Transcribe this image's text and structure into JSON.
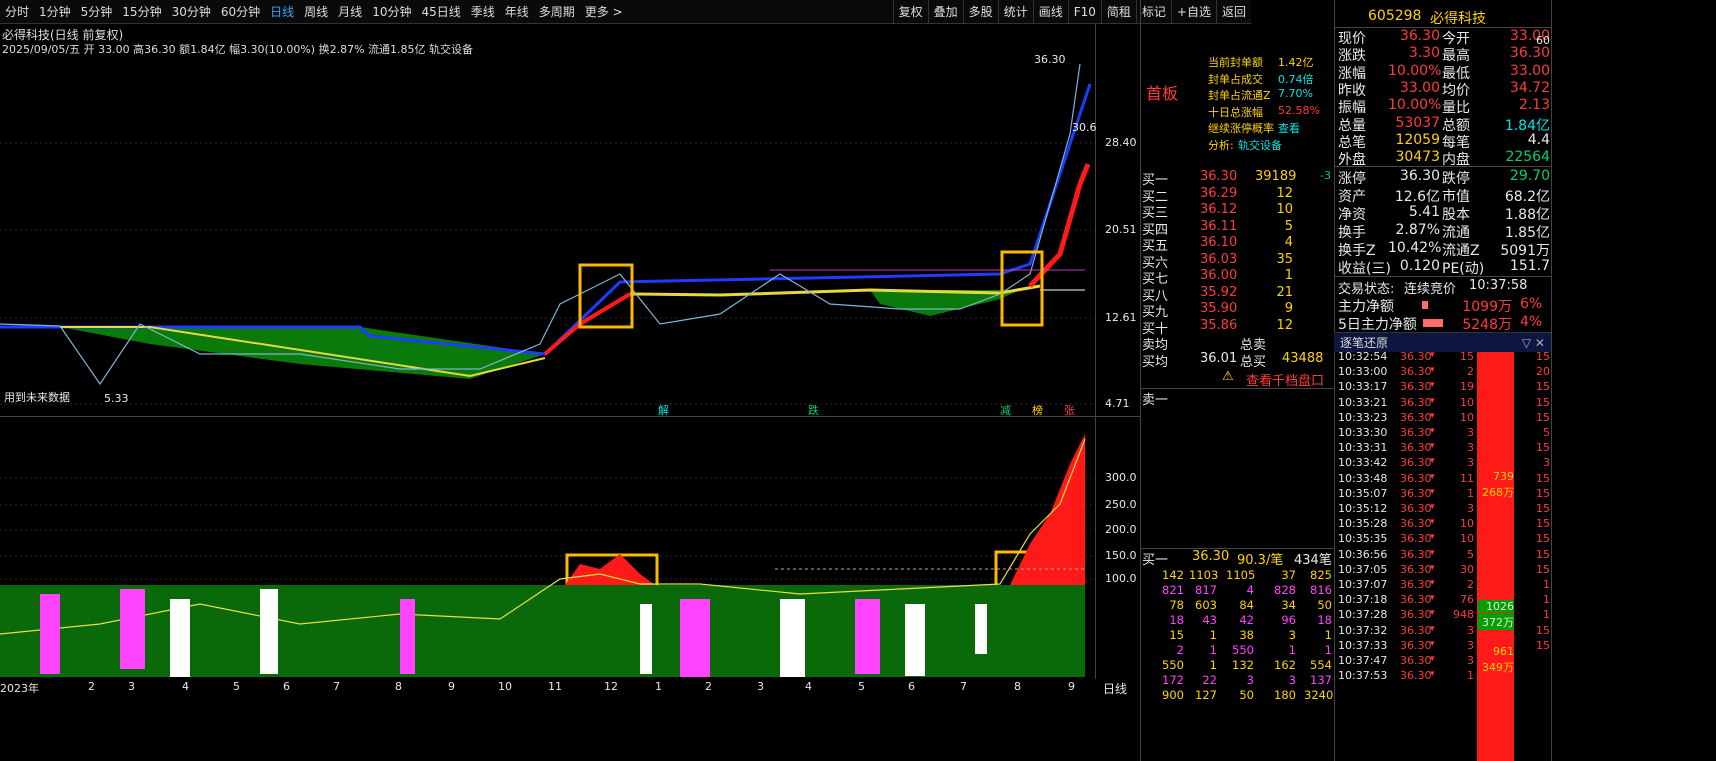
{
  "toolbar": {
    "left": [
      "分时",
      "1分钟",
      "5分钟",
      "15分钟",
      "30分钟",
      "60分钟",
      "日线",
      "周线",
      "月线",
      "10分钟",
      "45日线",
      "季线",
      "年线",
      "多周期",
      "更多 >"
    ],
    "selected": "日线",
    "right": [
      "复权",
      "叠加",
      "多股",
      "统计",
      "画线",
      "F10",
      "简租",
      "标记",
      "+自选",
      "返回"
    ]
  },
  "chart": {
    "title": "必得科技(日线 前复权)",
    "info": "2025/09/05/五 开 33.00 高36.30 额1.84亿 幅3.30(10.00%) 换2.87% 流通1.85亿 轨交设备",
    "yticks_main": [
      "28.40",
      "20.51",
      "12.61",
      "4.71"
    ],
    "high_label": "36.30",
    "low_label": "5.33",
    "price_right": "30.6",
    "yticks_sub": [
      "300.0",
      "250.0",
      "200.0",
      "150.0",
      "100.0"
    ],
    "future_note": "用到未来数据",
    "period_label": "日线",
    "xlabels": [
      "2023年",
      "2",
      "3",
      "4",
      "5",
      "6",
      "7",
      "8",
      "9",
      "10",
      "11",
      "12",
      "1",
      "2",
      "3",
      "4",
      "5",
      "6",
      "7",
      "8",
      "9"
    ],
    "markers": [
      "解",
      "跌",
      "减",
      "榜",
      "张"
    ]
  },
  "popup": {
    "title": "首板",
    "rows": [
      [
        "当前封单额",
        "1.42亿"
      ],
      [
        "封单占成交",
        "0.74倍"
      ],
      [
        "封单占流通Z",
        "7.70%"
      ],
      [
        "十日总涨幅",
        "52.58%"
      ],
      [
        "继续涨停概率",
        "查看"
      ],
      [
        "分析:",
        "轨交设备"
      ]
    ]
  },
  "stock": {
    "code": "605298",
    "name": "必得科技"
  },
  "quote": [
    [
      "现价",
      "36.30",
      "今开",
      "33.00"
    ],
    [
      "涨跌",
      "3.30",
      "最高",
      "36.30"
    ],
    [
      "涨幅",
      "10.00%",
      "最低",
      "33.00"
    ],
    [
      "昨收",
      "33.00",
      "均价",
      "34.72"
    ],
    [
      "振幅",
      "10.00%",
      "量比",
      "2.13"
    ],
    [
      "总量",
      "53037",
      "总额",
      "1.84亿"
    ],
    [
      "总笔",
      "12059",
      "每笔",
      "4.4"
    ],
    [
      "外盘",
      "30473",
      "内盘",
      "22564"
    ]
  ],
  "quote2": [
    [
      "涨停",
      "36.30",
      "跌停",
      "29.70"
    ],
    [
      "资产",
      "12.6亿",
      "市值",
      "68.2亿"
    ],
    [
      "净资",
      "5.41",
      "股本",
      "1.88亿"
    ],
    [
      "换手",
      "2.87%",
      "流通",
      "1.85亿"
    ],
    [
      "换手Z",
      "10.42%",
      "流通Z",
      "5091万"
    ],
    [
      "收益(三)",
      "0.120",
      "PE(动)",
      "151.7"
    ]
  ],
  "status": {
    "label": "交易状态:",
    "value": "连续竞价",
    "time": "10:37:58"
  },
  "flow": [
    [
      "主力净额",
      "1099万",
      "6%"
    ],
    [
      "5日主力净额",
      "5248万",
      "4%"
    ]
  ],
  "buys": [
    [
      "买一",
      "36.30",
      "39189",
      "-3"
    ],
    [
      "买二",
      "36.29",
      "12",
      ""
    ],
    [
      "买三",
      "36.12",
      "10",
      ""
    ],
    [
      "买四",
      "36.11",
      "5",
      ""
    ],
    [
      "买五",
      "36.10",
      "4",
      ""
    ],
    [
      "买六",
      "36.03",
      "35",
      ""
    ],
    [
      "买七",
      "36.00",
      "1",
      ""
    ],
    [
      "买八",
      "35.92",
      "21",
      ""
    ],
    [
      "买九",
      "35.90",
      "9",
      ""
    ],
    [
      "买十",
      "35.86",
      "12",
      ""
    ]
  ],
  "avg": {
    "sell_label": "卖均",
    "sell_total": "总卖",
    "buy_label": "买均",
    "buy_avg": "36.01",
    "buy_total_label": "总买",
    "buy_total": "43488"
  },
  "depth_link": "查看千档盘口",
  "sell1": "卖一",
  "queue": {
    "label": "买一",
    "price": "36.30",
    "avg": "90.3/笔",
    "count": "434笔",
    "rows": [
      [
        "142",
        "1103",
        "1105",
        "37",
        "825"
      ],
      [
        "821",
        "817",
        "4",
        "828",
        "816"
      ],
      [
        "78",
        "603",
        "84",
        "34",
        "50"
      ],
      [
        "18",
        "43",
        "42",
        "96",
        "18"
      ],
      [
        "15",
        "1",
        "38",
        "3",
        "1"
      ],
      [
        "2",
        "1",
        "550",
        "1",
        "1"
      ],
      [
        "550",
        "1",
        "132",
        "162",
        "554"
      ],
      [
        "172",
        "22",
        "3",
        "3",
        "137"
      ],
      [
        "900",
        "127",
        "50",
        "180",
        "3240"
      ]
    ]
  },
  "tick_header": "逐笔还原",
  "ticks": [
    [
      "10:32:54",
      "36.30",
      "15"
    ],
    [
      "10:33:00",
      "36.30",
      "2"
    ],
    [
      "10:33:17",
      "36.30",
      "19"
    ],
    [
      "10:33:21",
      "36.30",
      "10"
    ],
    [
      "10:33:23",
      "36.30",
      "10"
    ],
    [
      "10:33:30",
      "36.30",
      "3"
    ],
    [
      "10:33:31",
      "36.30",
      "3"
    ],
    [
      "10:33:42",
      "36.30",
      "3"
    ],
    [
      "10:33:48",
      "36.30",
      "11"
    ],
    [
      "10:35:07",
      "36.30",
      "1"
    ],
    [
      "10:35:12",
      "36.30",
      "3"
    ],
    [
      "10:35:28",
      "36.30",
      "10"
    ],
    [
      "10:35:35",
      "36.30",
      "10"
    ],
    [
      "10:36:56",
      "36.30",
      "5"
    ],
    [
      "10:37:05",
      "36.30",
      "30"
    ],
    [
      "10:37:07",
      "36.30",
      "2"
    ],
    [
      "10:37:18",
      "36.30",
      "76"
    ],
    [
      "10:37:28",
      "36.30",
      "948"
    ],
    [
      "10:37:32",
      "36.30",
      "3"
    ],
    [
      "10:37:33",
      "36.30",
      "3"
    ],
    [
      "10:37:47",
      "36.30",
      "3"
    ],
    [
      "10:37:53",
      "36.30",
      "1"
    ]
  ],
  "bars": [
    [
      "739",
      "268万"
    ],
    [
      "1026",
      "372万"
    ],
    [
      "961",
      "349万"
    ]
  ],
  "edge": [
    "60",
    "15",
    "20",
    "15",
    "15",
    "15",
    "5",
    "15",
    "3",
    "15",
    "15",
    "15",
    "15",
    "15",
    "15",
    "15",
    "1",
    "1",
    "1",
    "15",
    "15"
  ]
}
